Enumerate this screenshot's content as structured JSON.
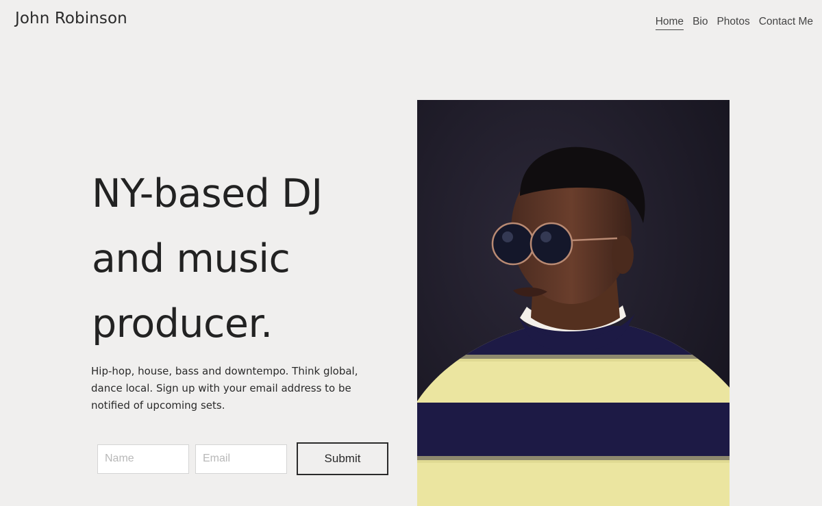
{
  "header": {
    "site_title": "John Robinson",
    "nav": [
      {
        "label": "Home",
        "active": true
      },
      {
        "label": "Bio",
        "active": false
      },
      {
        "label": "Photos",
        "active": false
      },
      {
        "label": "Contact Me",
        "active": false
      }
    ]
  },
  "hero": {
    "headline_lines": [
      "NY-based DJ",
      "and music",
      "producer."
    ],
    "description": "Hip-hop, house, bass and downtempo. Think global, dance local. Sign up with your email address to be notified of upcoming sets."
  },
  "signup": {
    "name_placeholder": "Name",
    "email_placeholder": "Email",
    "submit_label": "Submit"
  },
  "colors": {
    "page_background": "#f0efee",
    "text": "#222222",
    "sweater_yellow": "#ebe5a0",
    "sweater_navy": "#1d1a45",
    "photo_background": "#1e1b29"
  },
  "image": {
    "icon": "portrait-photo"
  }
}
